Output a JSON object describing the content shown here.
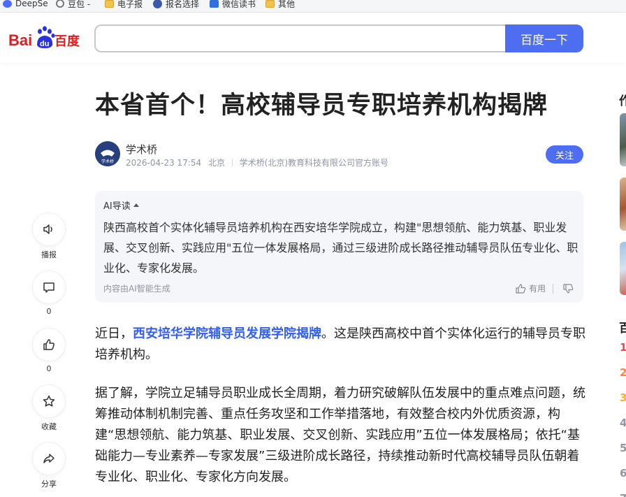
{
  "bookmarks": [
    {
      "label": "DeepSe",
      "icon": "deepseek-icon"
    },
    {
      "label": "豆包 -",
      "icon": "doubao-icon"
    },
    {
      "label": "电子报",
      "icon": "folder-icon"
    },
    {
      "label": "报名选择",
      "icon": "seal-icon"
    },
    {
      "label": "微信读书",
      "icon": "wechat-read-icon"
    },
    {
      "label": "其他",
      "icon": "folder-icon"
    }
  ],
  "header": {
    "logo_text_left": "Bai",
    "logo_text_paw": "du",
    "logo_text_right": "百度",
    "search_placeholder": "",
    "search_button": "百度一下"
  },
  "article": {
    "title": "本省首个！高校辅导员专职培养机构揭牌",
    "author": "学术桥",
    "avatar_text": "学术桥",
    "date": "2026-04-23 17:54",
    "location": "北京",
    "account_desc": "学术桥(北京)教育科技有限公司官方账号",
    "follow_label": "关注",
    "ai": {
      "title": "AI导读",
      "summary": "陕西高校首个实体化辅导员培养机构在西安培华学院成立，构建\"思想领航、能力筑基、职业发展、交叉创新、实践应用\"五位一体发展格局，通过三级进阶成长路径推动辅导员队伍专业化、职业化、专家化发展。",
      "footer": "内容由AI智能生成",
      "useful_label": "有用"
    },
    "p1_prefix": "近日，",
    "p1_link": "西安培华学院辅导员发展学院揭牌",
    "p1_suffix": "。这是陕西高校中首个实体化运行的辅导员专职培养机构。",
    "p2": "据了解，学院立足辅导员职业成长全周期，着力研究破解队伍发展中的重点难点问题，统筹推动体制机制完善、重点任务攻坚和工作举措落地，有效整合校内外优质资源，构建“思想领航、能力筑基、职业发展、交叉创新、实践应用”五位一体发展格局；依托“基础能力—专业素养—专家发展”三级进阶成长路径，持续推动新时代高校辅导员队伍朝着专业化、职业化、专家化方向发展。"
  },
  "rail": {
    "broadcast_label": "播报",
    "comment_count": "0",
    "like_count": "0",
    "favorite_label": "收藏",
    "share_label": "分享"
  },
  "right_sidebar": {
    "head1": "作",
    "head2": "百",
    "ranks": [
      "1",
      "2",
      "3",
      "4",
      "5",
      "6",
      "7"
    ],
    "rank_colors": [
      "#f54545",
      "#ff8547",
      "#ffac38",
      "#9195a3",
      "#9195a3",
      "#9195a3",
      "#9195a3"
    ]
  }
}
